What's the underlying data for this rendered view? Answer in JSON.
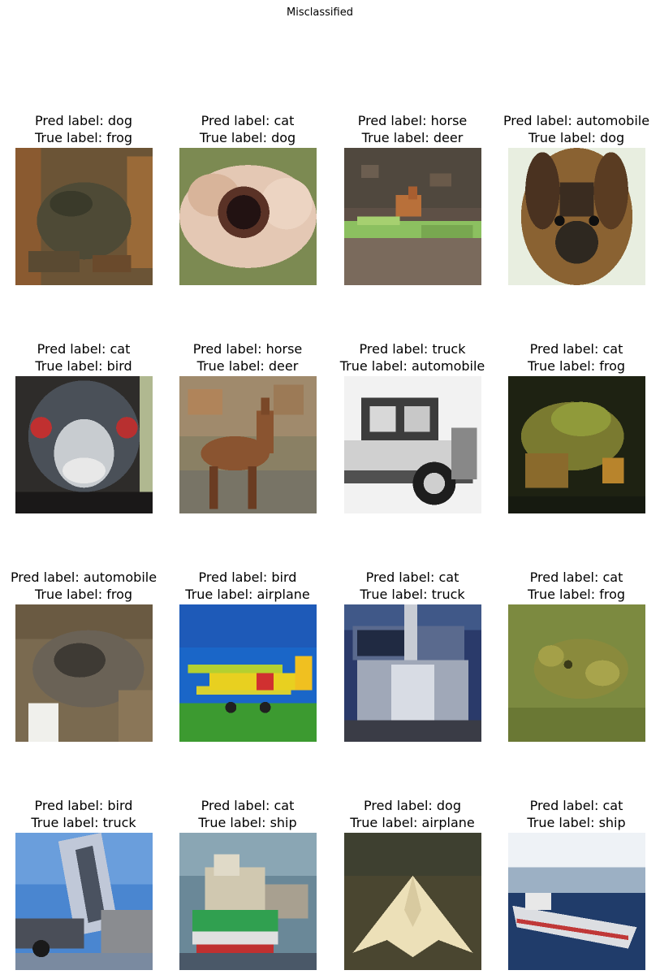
{
  "title": "Misclassified",
  "items": [
    {
      "pred": "Pred label: dog",
      "true": "True label: frog",
      "scene": "frog-brown"
    },
    {
      "pred": "Pred label: cat",
      "true": "True label: dog",
      "scene": "dog-fluffy"
    },
    {
      "pred": "Pred label: horse",
      "true": "True label: deer",
      "scene": "deer-field"
    },
    {
      "pred": "Pred label: automobile",
      "true": "True label: dog",
      "scene": "dog-face"
    },
    {
      "pred": "Pred label: cat",
      "true": "True label: bird",
      "scene": "emu-face"
    },
    {
      "pred": "Pred label: horse",
      "true": "True label: deer",
      "scene": "deer-standing"
    },
    {
      "pred": "Pred label: truck",
      "true": "True label: automobile",
      "scene": "old-car"
    },
    {
      "pred": "Pred label: cat",
      "true": "True label: frog",
      "scene": "frog-green-dark"
    },
    {
      "pred": "Pred label: automobile",
      "true": "True label: frog",
      "scene": "frog-grey"
    },
    {
      "pred": "Pred label: bird",
      "true": "True label: airplane",
      "scene": "biplane"
    },
    {
      "pred": "Pred label: cat",
      "true": "True label: truck",
      "scene": "truck-front"
    },
    {
      "pred": "Pred label: cat",
      "true": "True label: frog",
      "scene": "frog-green"
    },
    {
      "pred": "Pred label: bird",
      "true": "True label: truck",
      "scene": "dump-truck"
    },
    {
      "pred": "Pred label: cat",
      "true": "True label: ship",
      "scene": "ship-harbor"
    },
    {
      "pred": "Pred label: dog",
      "true": "True label: airplane",
      "scene": "stealth-plane"
    },
    {
      "pred": "Pred label: cat",
      "true": "True label: ship",
      "scene": "ship-sea"
    }
  ]
}
